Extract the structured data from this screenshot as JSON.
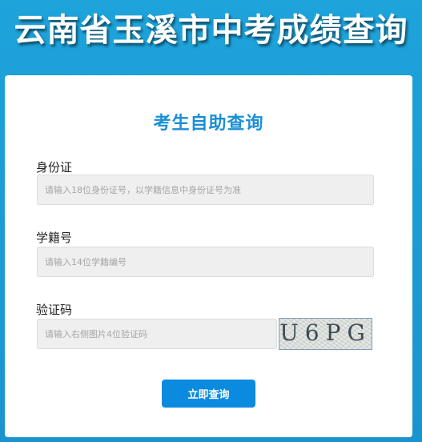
{
  "header": {
    "title": "云南省玉溪市中考成绩查询"
  },
  "form": {
    "title": "考生自助查询",
    "id_card": {
      "label": "身份证",
      "placeholder": "请输入18位身份证号，以学籍信息中身份证号为准"
    },
    "student_no": {
      "label": "学籍号",
      "placeholder": "请输入14位学籍编号"
    },
    "captcha": {
      "label": "验证码",
      "placeholder": "请输入右侧图片4位验证码",
      "image_text": "U6PG"
    },
    "submit_label": "立即查询"
  },
  "colors": {
    "background": "#1e9ad6",
    "accent": "#1a8fd6",
    "button": "#0a8be0"
  }
}
